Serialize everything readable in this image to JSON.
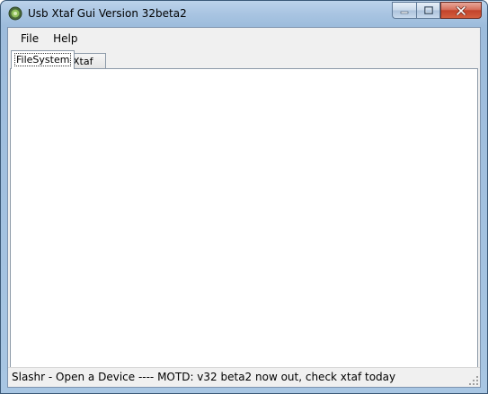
{
  "window": {
    "title": "Usb Xtaf Gui Version 32beta2"
  },
  "menubar": {
    "items": [
      {
        "label": "File"
      },
      {
        "label": "Help"
      }
    ]
  },
  "tabs": [
    {
      "label": "FileSystem",
      "active": true
    },
    {
      "label": "Xtaf Today",
      "active": false
    }
  ],
  "statusbar": {
    "text": "Slashr - Open a Device ---- MOTD: v32 beta2 now out, check xtaf today"
  },
  "icons": {
    "app": "app-icon",
    "minimize": "minimize-icon",
    "maximize": "maximize-icon",
    "close": "close-icon",
    "grip": "resize-grip-icon"
  },
  "colors": {
    "titlebar": "#a9c5e2",
    "close_button": "#c2432b",
    "client_bg": "#f0f0f0",
    "panel_bg": "#ffffff"
  }
}
